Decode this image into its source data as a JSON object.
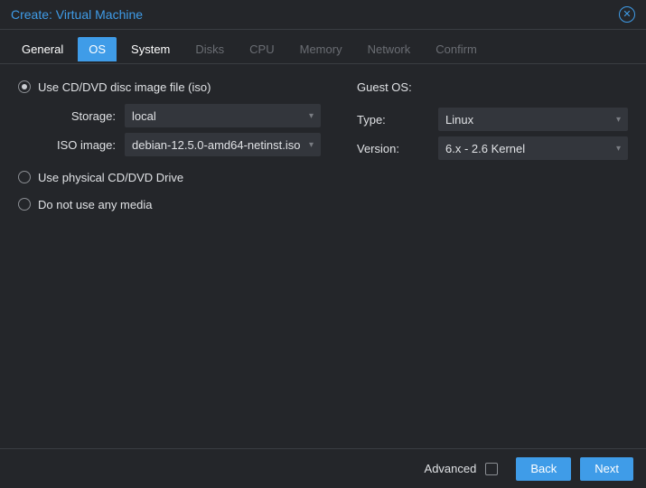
{
  "title": "Create: Virtual Machine",
  "tabs": {
    "general": "General",
    "os": "OS",
    "system": "System",
    "disks": "Disks",
    "cpu": "CPU",
    "memory": "Memory",
    "network": "Network",
    "confirm": "Confirm"
  },
  "media": {
    "use_iso_label": "Use CD/DVD disc image file (iso)",
    "storage_label": "Storage:",
    "storage_value": "local",
    "iso_label": "ISO image:",
    "iso_value": "debian-12.5.0-amd64-netinst.iso",
    "use_physical_label": "Use physical CD/DVD Drive",
    "use_none_label": "Do not use any media"
  },
  "guest_os": {
    "header": "Guest OS:",
    "type_label": "Type:",
    "type_value": "Linux",
    "version_label": "Version:",
    "version_value": "6.x - 2.6 Kernel"
  },
  "footer": {
    "advanced_label": "Advanced",
    "back_label": "Back",
    "next_label": "Next"
  }
}
